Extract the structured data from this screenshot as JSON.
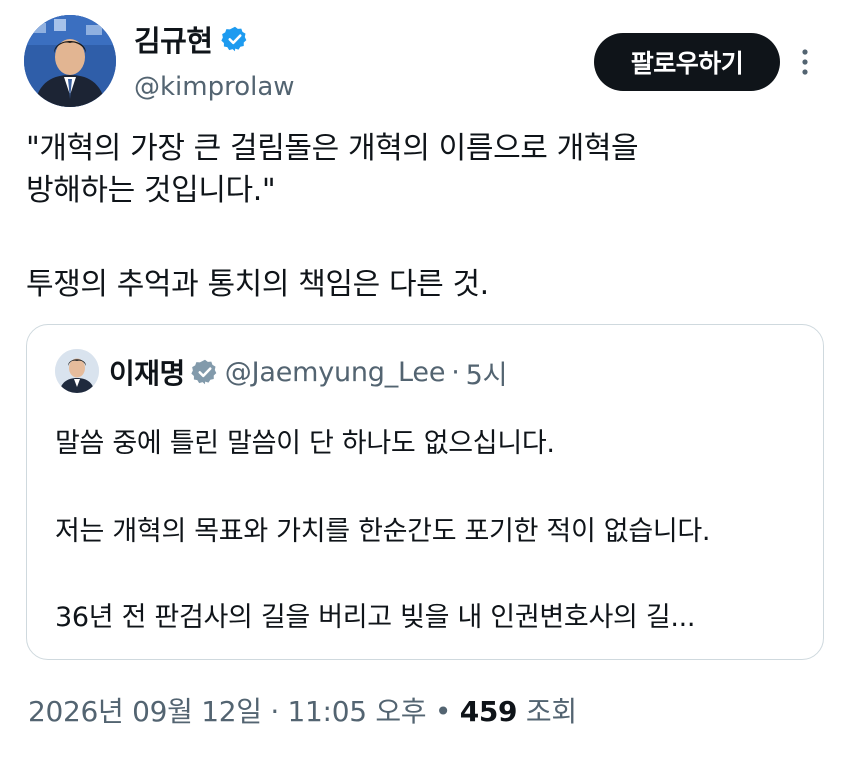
{
  "author": {
    "display_name": "김규현",
    "handle": "@kimprolaw",
    "verified_color": "#1d9bf0"
  },
  "actions": {
    "follow_label": "팔로우하기",
    "more_icon": "more-vertical-icon"
  },
  "tweet": {
    "lines": [
      "\"개혁의 가장 큰 걸림돌은 개혁의 이름으로 개혁을",
      "방해하는 것입니다.\"",
      "투쟁의 추억과 통치의 책임은 다른 것."
    ]
  },
  "quote": {
    "display_name": "이재명",
    "handle": "@Jaemyung_Lee",
    "separator": "·",
    "time": "5시",
    "verified_color": "#829aab",
    "lines": [
      "말씀 중에 틀린 말씀이 단 하나도 없으십니다.",
      "저는 개혁의 목표와 가치를 한순간도 포기한 적이 없습니다.",
      "36년 전 판검사의 길을 버리고 빚을 내 인권변호사의 길..."
    ]
  },
  "footer": {
    "date": "2026년 09월 12일",
    "separator1": "·",
    "time": "11:05 오후",
    "separator2": "•",
    "views_count": "459",
    "views_label": "조회"
  }
}
